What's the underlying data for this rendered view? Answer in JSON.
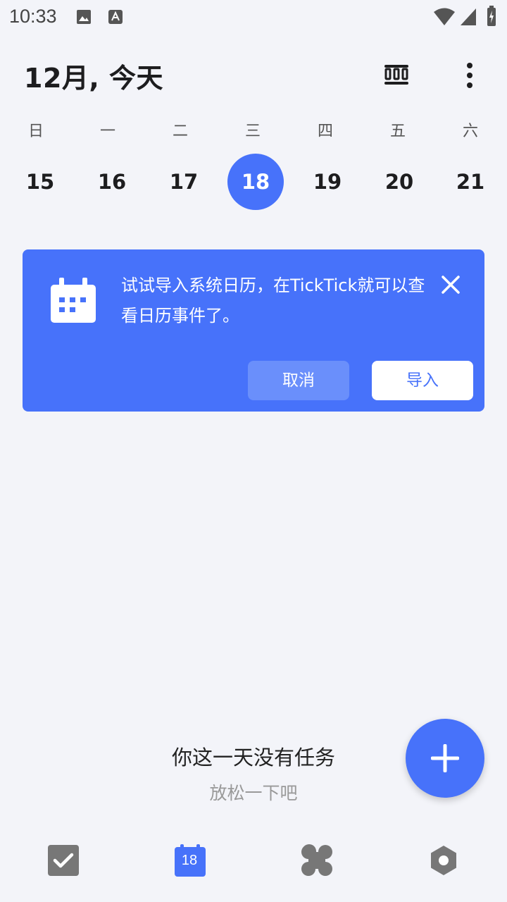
{
  "status_bar": {
    "time": "10:33"
  },
  "header": {
    "title": "12月, 今天"
  },
  "calendar": {
    "weekdays": [
      "日",
      "一",
      "二",
      "三",
      "四",
      "五",
      "六"
    ],
    "dates": [
      "15",
      "16",
      "17",
      "18",
      "19",
      "20",
      "21"
    ],
    "selected_index": 3
  },
  "banner": {
    "text": "试试导入系统日历，在TickTick就可以查看日历事件了。",
    "cancel_label": "取消",
    "import_label": "导入"
  },
  "empty_state": {
    "title": "你这一天没有任务",
    "subtitle": "放松一下吧"
  },
  "bottom_nav": {
    "calendar_day": "18"
  },
  "colors": {
    "accent": "#4772fa",
    "background": "#f3f4f9",
    "nav_inactive": "#777777"
  }
}
